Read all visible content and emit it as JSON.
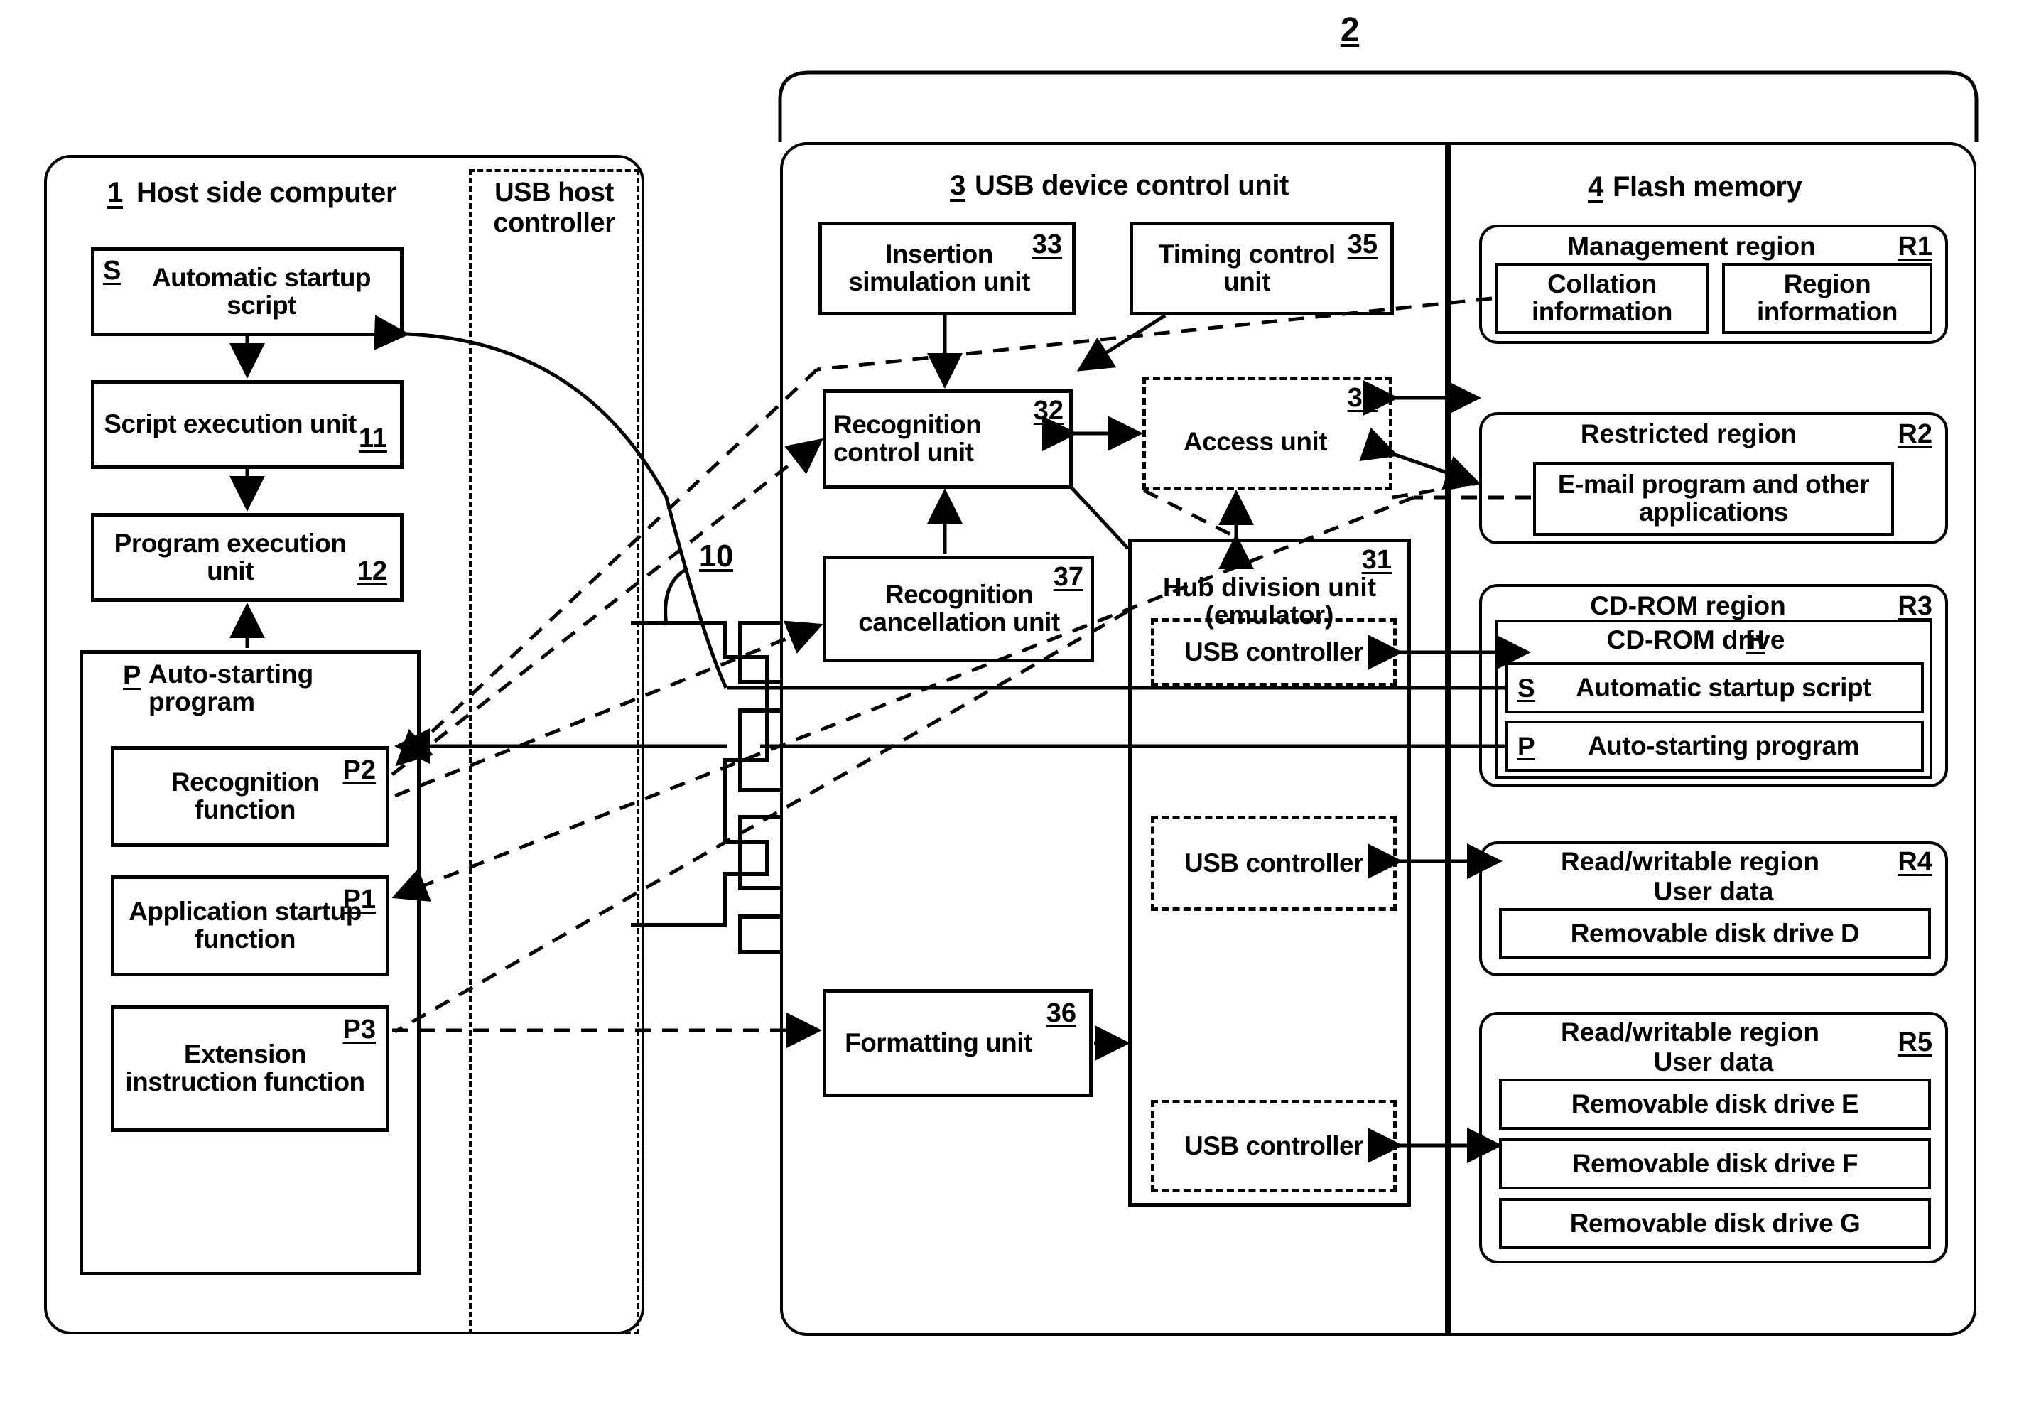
{
  "figure": {
    "top_label": "2"
  },
  "host_panel": {
    "title_num": "1",
    "title": "Host side computer",
    "boxes": [
      {
        "tag": "S",
        "text": "Automatic startup script",
        "num": ""
      },
      {
        "tag": "",
        "text": "Script execution unit",
        "num": "11"
      },
      {
        "tag": "",
        "text": "Program execution unit",
        "num": "12"
      }
    ],
    "program_group": {
      "tag": "P",
      "title": "Auto-starting program",
      "items": [
        {
          "text": "Recognition function",
          "num": "P2"
        },
        {
          "text": "Application startup function",
          "num": "P1"
        },
        {
          "text": "Extension instruction function",
          "num": "P3"
        }
      ]
    }
  },
  "usb_host_controller": {
    "label": "USB host controller"
  },
  "connector": {
    "num": "10"
  },
  "device_panel": {
    "title_num": "3",
    "title": "USB device control unit",
    "boxes": [
      {
        "text": "Insertion simulation unit",
        "num": "33"
      },
      {
        "text": "Timing control unit",
        "num": "35"
      },
      {
        "text": "Recognition control unit",
        "num": "32"
      },
      {
        "text": "Access unit",
        "num": "34"
      },
      {
        "text": "Recognition cancellation unit",
        "num": "37"
      },
      {
        "text": "Formatting unit",
        "num": "36"
      }
    ],
    "hub": {
      "title": "Hub division unit (emulator)",
      "num": "31",
      "controllers": [
        "USB controller",
        "USB controller",
        "USB controller"
      ]
    }
  },
  "flash_panel": {
    "title_num": "4",
    "title": "Flash memory",
    "regions": [
      {
        "title": "Management region",
        "num": "R1",
        "items": [
          "Collation information",
          "Region information"
        ]
      },
      {
        "title": "Restricted region",
        "num": "R2",
        "items": [
          "E-mail program and other applications"
        ]
      },
      {
        "title": "CD-ROM region",
        "num": "R3",
        "drive_title": "CD-ROM drive",
        "drive_letter": "H",
        "items": [
          {
            "tag": "S",
            "text": "Automatic startup script"
          },
          {
            "tag": "P",
            "text": "Auto-starting program"
          }
        ]
      },
      {
        "title": "Read/writable region",
        "num": "R4",
        "subtitle": "User data",
        "items": [
          "Removable disk drive D"
        ]
      },
      {
        "title": "Read/writable region",
        "num": "R5",
        "subtitle": "User data",
        "items": [
          "Removable disk drive E",
          "Removable disk drive F",
          "Removable disk drive G"
        ]
      }
    ]
  }
}
